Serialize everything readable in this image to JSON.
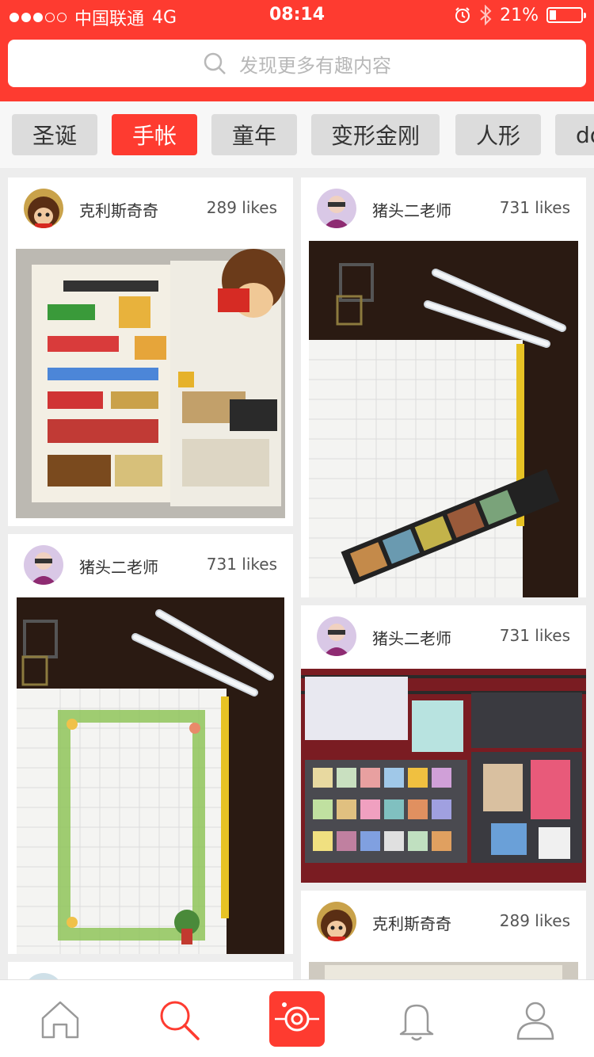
{
  "status_bar": {
    "carrier": "中国联通",
    "network": "4G",
    "time": "08:14",
    "battery": "21%",
    "battery_level": 0.21
  },
  "search": {
    "placeholder": "发现更多有趣内容"
  },
  "tabs": [
    {
      "label": "圣诞",
      "active": false
    },
    {
      "label": "手帐",
      "active": true
    },
    {
      "label": "童年",
      "active": false
    },
    {
      "label": "变形金刚",
      "active": false
    },
    {
      "label": "人形",
      "active": false
    },
    {
      "label": "do",
      "active": false
    }
  ],
  "posts": [
    {
      "user": "克利斯奇奇",
      "likes": "289 likes"
    },
    {
      "user": "猪头二老师",
      "likes": "731 likes"
    },
    {
      "user": "猪头二老师",
      "likes": "731 likes"
    },
    {
      "user": "猪头二老师",
      "likes": "731 likes"
    },
    {
      "user": "克利斯奇奇",
      "likes": "289 likes"
    }
  ],
  "colors": {
    "accent": "#fe3b30",
    "background": "#ededed"
  },
  "tabbar": [
    {
      "icon": "home-icon"
    },
    {
      "icon": "search-icon",
      "active": true
    },
    {
      "icon": "camera-icon"
    },
    {
      "icon": "bell-icon"
    },
    {
      "icon": "profile-icon"
    }
  ]
}
